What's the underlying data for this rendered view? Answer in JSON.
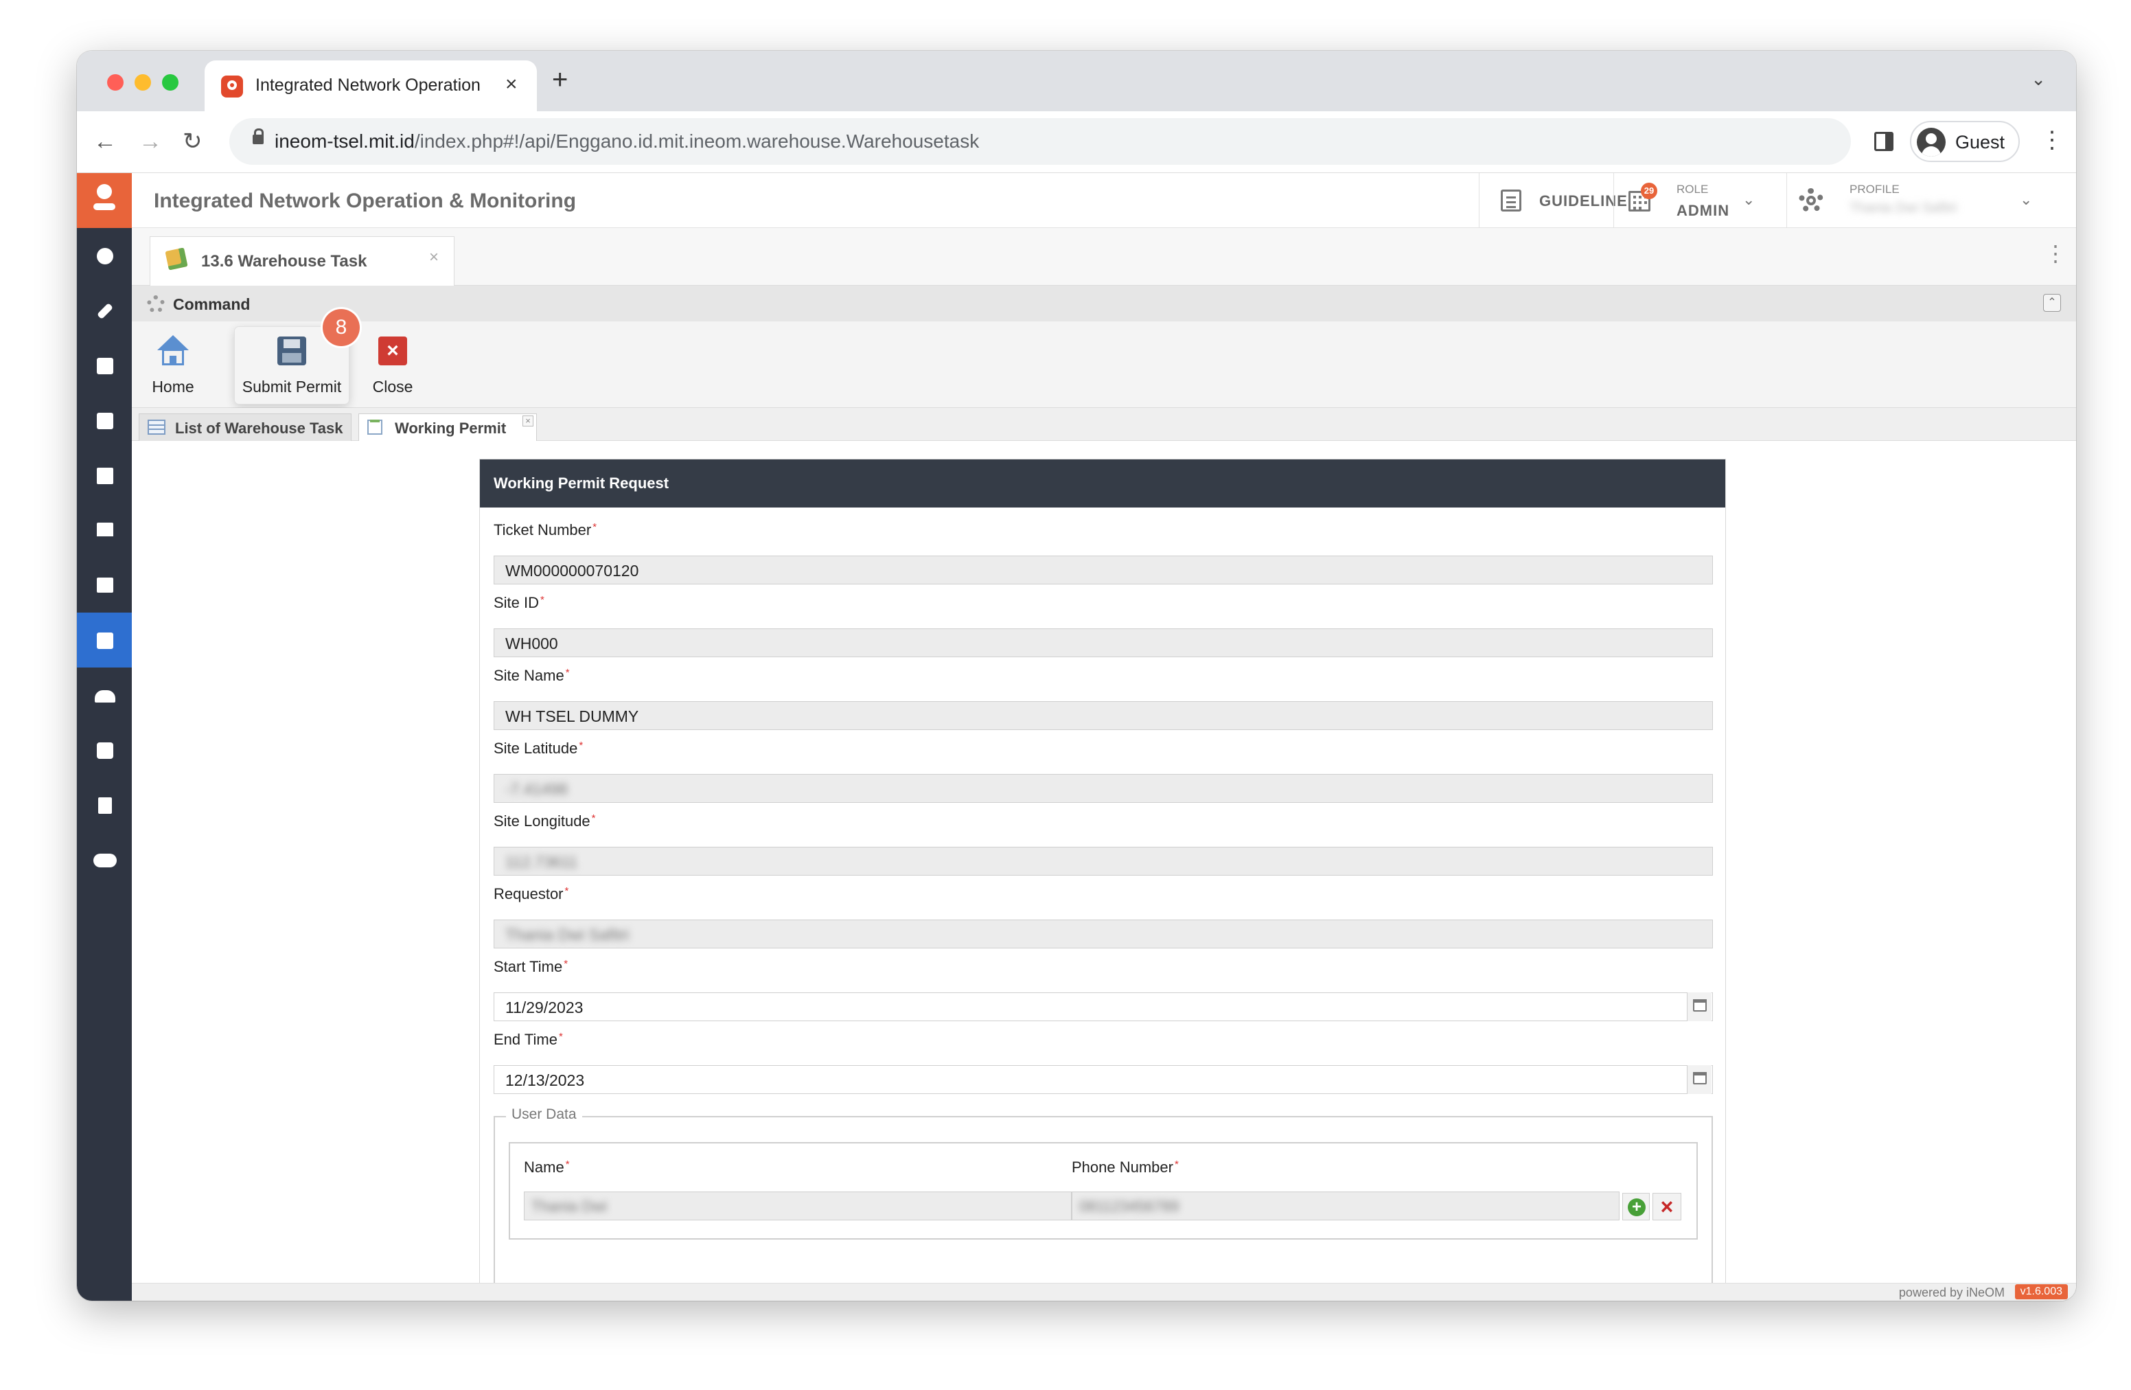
{
  "browser": {
    "tab_title": "Integrated Network Operation",
    "url_host": "ineom-tsel.mit.id",
    "url_path": "/index.php#!/api/Enggano.id.mit.ineom.warehouse.Warehousetask",
    "profile_label": "Guest"
  },
  "header": {
    "app_title": "Integrated Network Operation & Monitoring",
    "guideline_label": "GUIDELINE",
    "role_caption": "ROLE",
    "role_value": "ADMIN",
    "role_badge_count": "29",
    "profile_caption": "PROFILE",
    "profile_value": "Thania Dwi Safitri"
  },
  "sidebar": {
    "items": [
      {
        "icon": "dashboard-icon"
      },
      {
        "icon": "wrench-icon"
      },
      {
        "icon": "clipboard-icon"
      },
      {
        "icon": "clipboard-check-icon"
      },
      {
        "icon": "image-icon"
      },
      {
        "icon": "store-icon"
      },
      {
        "icon": "server-icon"
      },
      {
        "icon": "archive-icon",
        "active": true
      },
      {
        "icon": "people-icon"
      },
      {
        "icon": "puzzle-icon"
      },
      {
        "icon": "book-icon"
      },
      {
        "icon": "cloud-icon"
      }
    ]
  },
  "workspace": {
    "tab_label": "13.6 Warehouse Task",
    "command_title": "Command",
    "commands": {
      "home": "Home",
      "submit": "Submit Permit",
      "close": "Close"
    },
    "step_badge": "8",
    "subtabs": {
      "list": "List of Warehouse Task",
      "permit": "Working Permit"
    }
  },
  "form": {
    "title": "Working Permit Request",
    "fields": {
      "ticket_number": {
        "label": "Ticket Number",
        "value": "WM000000070120"
      },
      "site_id": {
        "label": "Site ID",
        "value": "WH000"
      },
      "site_name": {
        "label": "Site Name",
        "value": "WH TSEL DUMMY"
      },
      "site_latitude": {
        "label": "Site Latitude",
        "value": "-7.41498"
      },
      "site_longitude": {
        "label": "Site Longitude",
        "value": "112.73611"
      },
      "requestor": {
        "label": "Requestor",
        "value": "Thania Dwi Safitri"
      },
      "start_time": {
        "label": "Start Time",
        "value": "11/29/2023"
      },
      "end_time": {
        "label": "End Time",
        "value": "12/13/2023"
      }
    },
    "user_data": {
      "legend": "User Data",
      "name_label": "Name",
      "phone_label": "Phone Number",
      "name_value": "Thania Dwi",
      "phone_value": "081123456789"
    },
    "required_mark": "*"
  },
  "footer": {
    "powered_by": "powered by iNeOM",
    "version": "v1.6.003"
  }
}
